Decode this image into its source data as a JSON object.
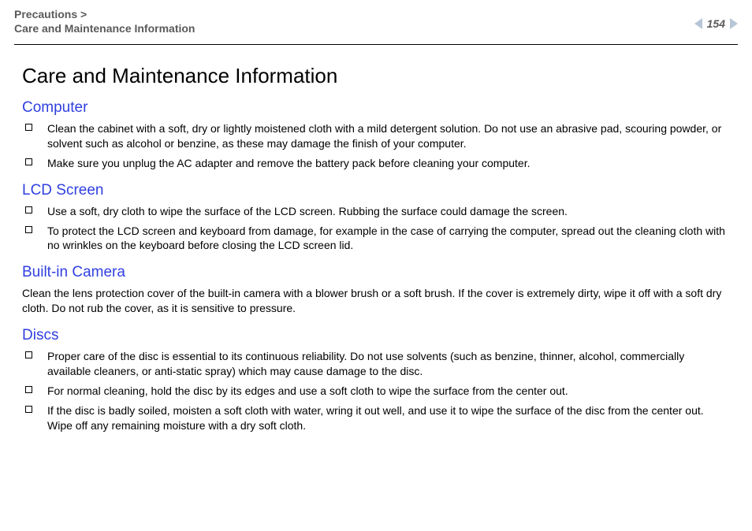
{
  "header": {
    "breadcrumb_line1": "Precautions >",
    "breadcrumb_line2": "Care and Maintenance Information",
    "page_number": "154"
  },
  "title": "Care and Maintenance Information",
  "sections": {
    "computer": {
      "heading": "Computer",
      "items": [
        "Clean the cabinet with a soft, dry or lightly moistened cloth with a mild detergent solution. Do not use an abrasive pad, scouring powder, or solvent such as alcohol or benzine, as these may damage the finish of your computer.",
        "Make sure you unplug the AC adapter and remove the battery pack before cleaning your computer."
      ]
    },
    "lcd": {
      "heading": "LCD Screen",
      "items": [
        "Use a soft, dry cloth to wipe the surface of the LCD screen. Rubbing the surface could damage the screen.",
        "To protect the LCD screen and keyboard from damage, for example in the case of carrying the computer, spread out the cleaning cloth with no wrinkles on the keyboard before closing the LCD screen lid."
      ]
    },
    "camera": {
      "heading": "Built-in Camera",
      "body": "Clean the lens protection cover of the built-in camera with a blower brush or a soft brush. If the cover is extremely dirty, wipe it off with a soft dry cloth. Do not rub the cover, as it is sensitive to pressure."
    },
    "discs": {
      "heading": "Discs",
      "items": [
        "Proper care of the disc is essential to its continuous reliability. Do not use solvents (such as benzine, thinner, alcohol, commercially available cleaners, or anti-static spray) which may cause damage to the disc.",
        "For normal cleaning, hold the disc by its edges and use a soft cloth to wipe the surface from the center out.",
        "If the disc is badly soiled, moisten a soft cloth with water, wring it out well, and use it to wipe the surface of the disc from the center out. Wipe off any remaining moisture with a dry soft cloth."
      ]
    }
  }
}
